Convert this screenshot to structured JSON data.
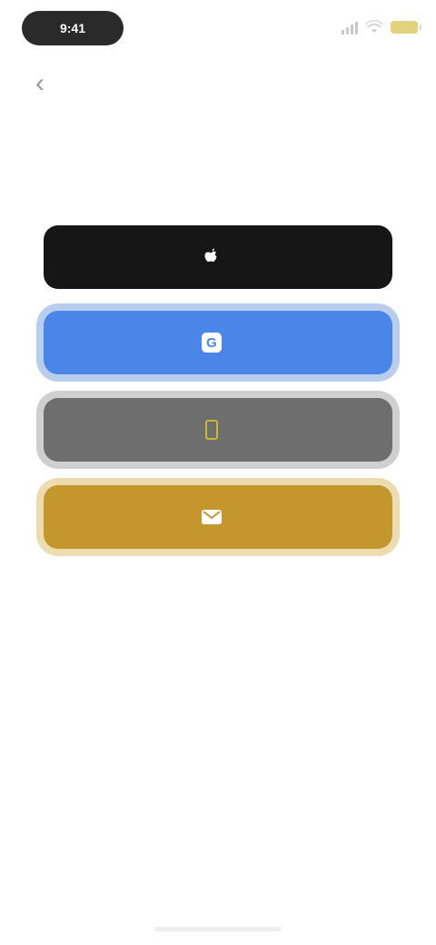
{
  "status_bar": {
    "time": "9:41"
  },
  "header": {
    "back_glyph": "‹"
  },
  "main": {
    "title": "",
    "subtitle": ""
  },
  "options": [
    {
      "id": "apple",
      "label": "",
      "icon": "apple-icon",
      "color": "#161616"
    },
    {
      "id": "google",
      "label": "",
      "icon": "google-icon",
      "color": "#4a86e8"
    },
    {
      "id": "phone",
      "label": "",
      "icon": "phone-icon",
      "color": "#6e6e6e"
    },
    {
      "id": "email",
      "label": "",
      "icon": "mail-icon",
      "color": "#c4962e"
    }
  ],
  "legal": {
    "text": ""
  },
  "footer": {
    "link_text": ""
  },
  "colors": {
    "accent": "#c4962e",
    "google_blue": "#4a86e8",
    "dark": "#161616"
  }
}
